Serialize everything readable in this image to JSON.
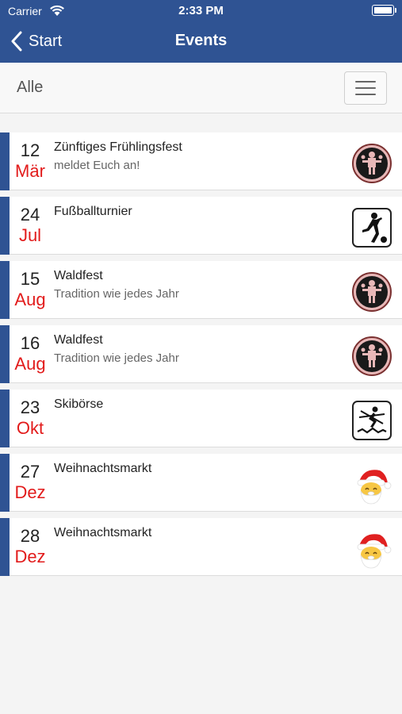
{
  "status": {
    "carrier": "Carrier",
    "time": "2:33 PM"
  },
  "nav": {
    "back_label": "Start",
    "title": "Events"
  },
  "filter": {
    "label": "Alle"
  },
  "events": [
    {
      "day": "12",
      "month": "Mär",
      "title": "Zünftiges Frühlingsfest",
      "subtitle": "meldet Euch an!",
      "icon": "club-emblem-icon"
    },
    {
      "day": "24",
      "month": "Jul",
      "title": "Fußballturnier",
      "subtitle": "",
      "icon": "football-player-icon"
    },
    {
      "day": "15",
      "month": "Aug",
      "title": "Waldfest",
      "subtitle": "Tradition wie jedes Jahr",
      "icon": "club-emblem-icon"
    },
    {
      "day": "16",
      "month": "Aug",
      "title": "Waldfest",
      "subtitle": "Tradition wie jedes Jahr",
      "icon": "club-emblem-icon"
    },
    {
      "day": "23",
      "month": "Okt",
      "title": "Skibörse",
      "subtitle": "",
      "icon": "skier-icon"
    },
    {
      "day": "27",
      "month": "Dez",
      "title": "Weihnachtsmarkt",
      "subtitle": "",
      "icon": "santa-icon"
    },
    {
      "day": "28",
      "month": "Dez",
      "title": "Weihnachtsmarkt",
      "subtitle": "",
      "icon": "santa-icon"
    }
  ],
  "colors": {
    "nav_bar": "#2f5393",
    "stripe": "#2f5393",
    "month_text": "#e21b1b",
    "background": "#f4f4f4"
  }
}
